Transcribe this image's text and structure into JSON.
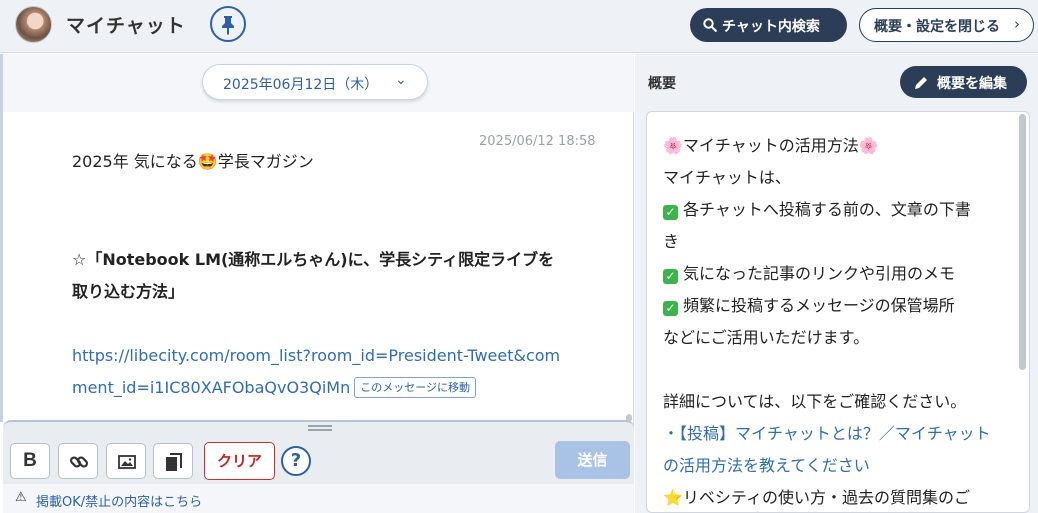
{
  "header": {
    "title": "マイチャット",
    "search_label": "チャット内検索",
    "close_label": "概要・設定を閉じる",
    "close_chevron": "›",
    "colors": {
      "header_bg": "#eef1f6",
      "dark_button": "#2c3e57",
      "accent": "#2d5fa8"
    }
  },
  "chat": {
    "date_label": "2025年06月12日（木）",
    "date_chevron": "⌄",
    "message": {
      "timestamp": "2025/06/12 18:58",
      "line1": "2025年 気になる🤩学長マガジン",
      "bold_line1": "☆「Notebook LM(通称エルちゃん)に、学長シティ限定ライブを",
      "bold_line2": "取り込む方法」",
      "link_line1": "https://libecity.com/room_list?room_id=President-Tweet&com",
      "link_line2": "ment_id=i1IC80XAFObaQvO3QiMn",
      "jump_label": "このメッセージに移動"
    }
  },
  "composer": {
    "bold_label": "B",
    "clear_label": "クリア",
    "help_label": "?",
    "send_label": "送信",
    "notice_icon": "⚠",
    "notice_text": "掲載OK/禁止の内容はこちら"
  },
  "summary": {
    "title": "概要",
    "edit_label": "概要を編集",
    "heading": "マイチャットの活用方法",
    "flower_emoji": "🌸",
    "intro": "マイチャットは、",
    "check_mark": "✓",
    "item1_a": "各チャットへ投稿する前の、文章の下書",
    "item1_b": "き",
    "item2": "気になった記事のリンクや引用のメモ",
    "item3": "頻繁に投稿するメッセージの保管場所",
    "closing": "などにご活用いただけます。",
    "details": "詳細については、以下をご確認ください。",
    "link_a": "・【投稿】マイチャットとは？／マイチャット",
    "link_b": "の活用方法を教えてください",
    "star_emoji": "⭐",
    "footer_partial": "リベシティの使い方・過去の質問集のご"
  }
}
